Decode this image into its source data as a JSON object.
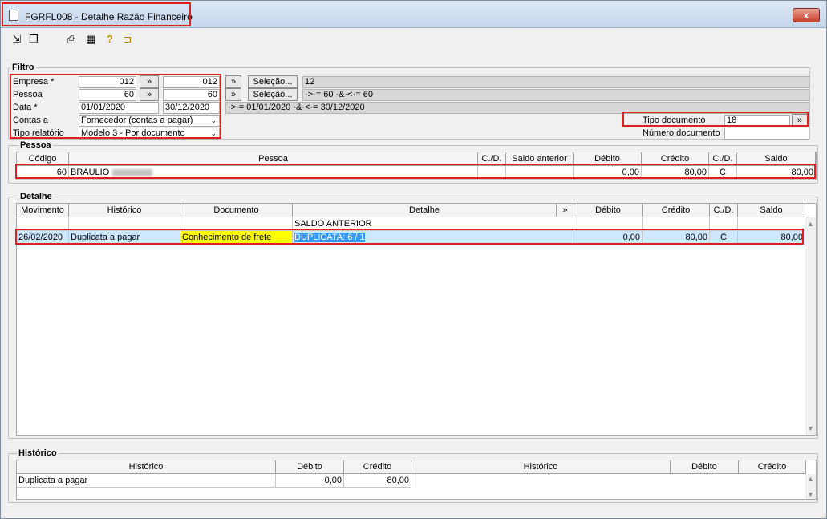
{
  "window": {
    "title": "FGRFL008 - Detalhe Razão Financeiro",
    "close": "x"
  },
  "toolbar": {
    "icons": [
      "export-icon",
      "copy-icon",
      "print-icon",
      "calculator-icon",
      "help-icon",
      "exit-door-icon"
    ]
  },
  "filtro": {
    "legend": "Filtro",
    "empresa_label": "Empresa *",
    "empresa_from": "012",
    "empresa_to": "012",
    "pessoa_label": "Pessoa",
    "pessoa_from": "60",
    "pessoa_to": "60",
    "data_label": "Data *",
    "data_from": "01/01/2020",
    "data_to": "30/12/2020",
    "contas_label": "Contas a",
    "contas_value": "Fornecedor (contas a pagar)",
    "tipo_rel_label": "Tipo relatório",
    "tipo_rel_value": "Modelo 3 - Por documento",
    "range_btn": "»",
    "selecao_label": "Seleção...",
    "empresa_summary": "12",
    "pessoa_summary": "·>·= 60 ·&·<·= 60",
    "data_summary": "·>·= 01/01/2020 ·&·<·= 30/12/2020",
    "tipo_doc_label": "Tipo documento",
    "tipo_doc_value": "18",
    "num_doc_label": "Número documento",
    "num_doc_value": ""
  },
  "pessoa": {
    "legend": "Pessoa",
    "headers": [
      "Código",
      "Pessoa",
      "C./D.",
      "Saldo anterior",
      "Débito",
      "Crédito",
      "C./D.",
      "Saldo"
    ],
    "row": {
      "codigo": "60",
      "nome": "BRAULIO",
      "cd1": "",
      "saldo_anterior": "",
      "debito": "0,00",
      "credito": "80,00",
      "cd2": "C",
      "saldo": "80,00"
    }
  },
  "detalhe": {
    "legend": "Detalhe",
    "headers": [
      "Movimento",
      "Histórico",
      "Documento",
      "Detalhe",
      "»",
      "Débito",
      "Crédito",
      "C./D.",
      "Saldo"
    ],
    "saldo_anterior_row": {
      "detalhe": "SALDO ANTERIOR"
    },
    "rows": [
      {
        "movimento": "26/02/2020",
        "historico": "Duplicata a pagar",
        "documento": "Conhecimento de frete",
        "detalhe": "DUPLICATA: 6 / 1",
        "debito": "0,00",
        "credito": "80,00",
        "cd": "C",
        "saldo": "80,00"
      }
    ]
  },
  "historico": {
    "legend": "Histórico",
    "headers_left": [
      "Histórico",
      "Débito",
      "Crédito"
    ],
    "headers_right": [
      "Histórico",
      "Débito",
      "Crédito"
    ],
    "row": {
      "historico": "Duplicata a pagar",
      "debito": "0,00",
      "credito": "80,00"
    }
  },
  "colors": {
    "highlight_yellow": "#ffff00",
    "selection_blue": "#3399ff",
    "row_select": "#cde8ff",
    "annotation_red": "#e02020"
  }
}
